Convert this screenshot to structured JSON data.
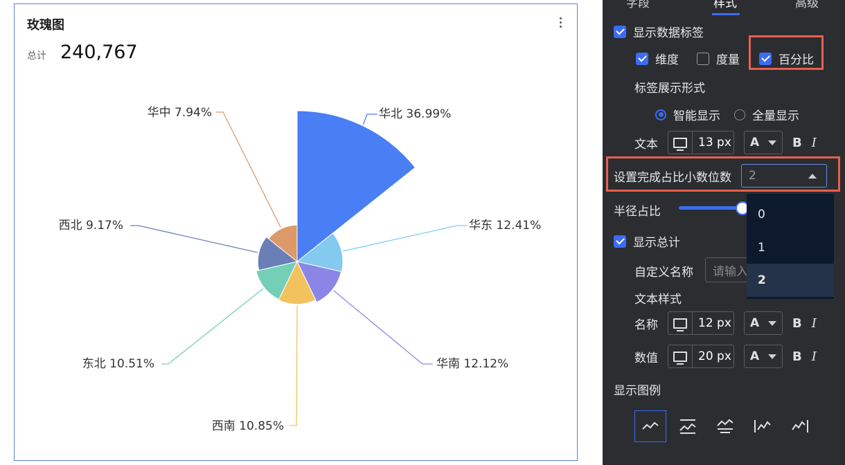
{
  "card": {
    "title": "玫瑰图",
    "total_label": "总计",
    "total_value": "240,767"
  },
  "chart_data": {
    "type": "pie",
    "variant": "rose",
    "title": "玫瑰图",
    "total": 240767,
    "slices": [
      {
        "label": "华北",
        "pct_label": "36.99%",
        "value": 36.99,
        "color": "#4a7ef5"
      },
      {
        "label": "华东",
        "pct_label": "12.41%",
        "value": 12.41,
        "color": "#83c9f0"
      },
      {
        "label": "华南",
        "pct_label": "12.12%",
        "value": 12.12,
        "color": "#8b86e6"
      },
      {
        "label": "西南",
        "pct_label": "10.85%",
        "value": 10.85,
        "color": "#f2c25e"
      },
      {
        "label": "东北",
        "pct_label": "10.51%",
        "value": 10.51,
        "color": "#74cfb7"
      },
      {
        "label": "西北",
        "pct_label": "9.17%",
        "value": 9.17,
        "color": "#6a7fb8"
      },
      {
        "label": "华中",
        "pct_label": "7.94%",
        "value": 7.94,
        "color": "#dc9a6a"
      }
    ]
  },
  "panel": {
    "tabs": [
      "字段",
      "样式",
      "高级"
    ],
    "show_data_labels": "显示数据标签",
    "dimension": "维度",
    "measure": "度量",
    "percent": "百分比",
    "label_format_title": "标签展示形式",
    "smart_display": "智能显示",
    "full_display": "全量显示",
    "text_label": "文本",
    "text_size": "13 px",
    "decimal_label": "设置完成占比小数位数",
    "decimal_value": "2",
    "radius_label": "半径占比",
    "dropdown_options": [
      "0",
      "1",
      "2"
    ],
    "show_total": "显示总计",
    "custom_name_label": "自定义名称",
    "custom_name_placeholder": "请输入",
    "text_style_label": "文本样式",
    "name_label": "名称",
    "name_size": "12 px",
    "value_label": "数值",
    "value_size": "20 px",
    "show_legend": "显示图例",
    "color_glyph": "A",
    "bold_glyph": "B",
    "italic_glyph": "I"
  },
  "colors": {
    "accent": "#3b6cf6",
    "highlight": "#e8604c",
    "panel_bg": "#2b2d31"
  }
}
